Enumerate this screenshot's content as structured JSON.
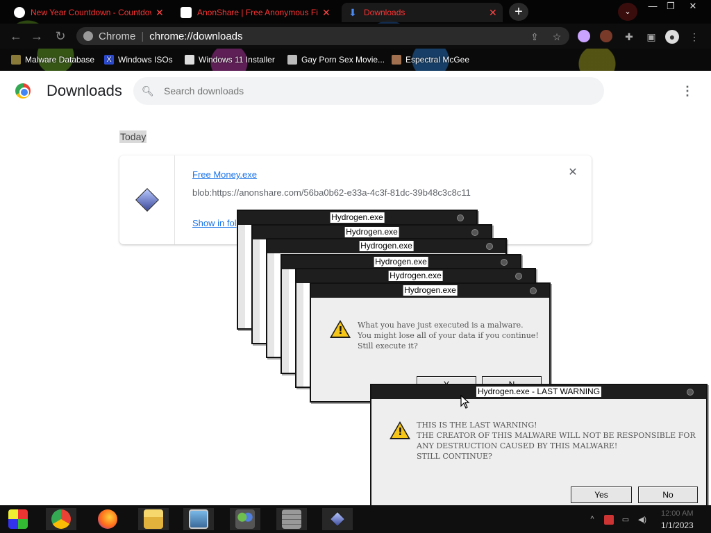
{
  "browser": {
    "tabs": [
      {
        "title": "New Year Countdown - Countdown",
        "favicon": "clock-icon",
        "active": false
      },
      {
        "title": "AnonShare | Free Anonymous File",
        "favicon": "anonshare-icon",
        "active": false
      },
      {
        "title": "Downloads",
        "favicon": "download-icon",
        "active": true
      }
    ],
    "new_tab_label": "+",
    "omnibox": {
      "site_label": "Chrome",
      "url": "chrome://downloads"
    },
    "bookmarks": [
      {
        "label": "Malware Database",
        "icon": "bookmark-icon"
      },
      {
        "label": "Windows ISOs",
        "icon": "x-icon"
      },
      {
        "label": "Windows 11 Installer",
        "icon": "installer-icon"
      },
      {
        "label": "Gay Porn Sex Movie...",
        "icon": "site-icon"
      },
      {
        "label": "Espectral McGee",
        "icon": "site-icon"
      }
    ]
  },
  "downloads": {
    "title": "Downloads",
    "search_placeholder": "Search downloads",
    "section": "Today",
    "items": [
      {
        "file_name": "Free Money.exe",
        "url": "blob:https://anonshare.com/56ba0b62-e33a-4c3f-81dc-39b48c3c8c11",
        "action": "Show in fol"
      }
    ]
  },
  "dialogs": {
    "stack_title": "Hydrogen.exe",
    "stack_message": "What you have just executed is a malware.\nYou might lose all of your data if you continue!\nStill execute it?",
    "stack_buttons": {
      "yes": "Y",
      "no": "N"
    },
    "final": {
      "title": "Hydrogen.exe - LAST WARNING",
      "message": "THIS IS THE LAST WARNING!\nTHE CREATOR OF THIS MALWARE WILL NOT BE RESPONSIBLE FOR\nANY DESTRUCTION CAUSED BY THIS MALWARE!\nSTILL CONTINUE?",
      "yes": "Yes",
      "no": "No"
    }
  },
  "taskbar": {
    "apps": [
      "start-icon",
      "chrome-icon",
      "firefox-icon",
      "file-explorer-icon",
      "photos-icon",
      "people-icon",
      "wall-icon",
      "hydrogen-icon"
    ],
    "time": "12:00 AM",
    "date": "1/1/2023"
  }
}
